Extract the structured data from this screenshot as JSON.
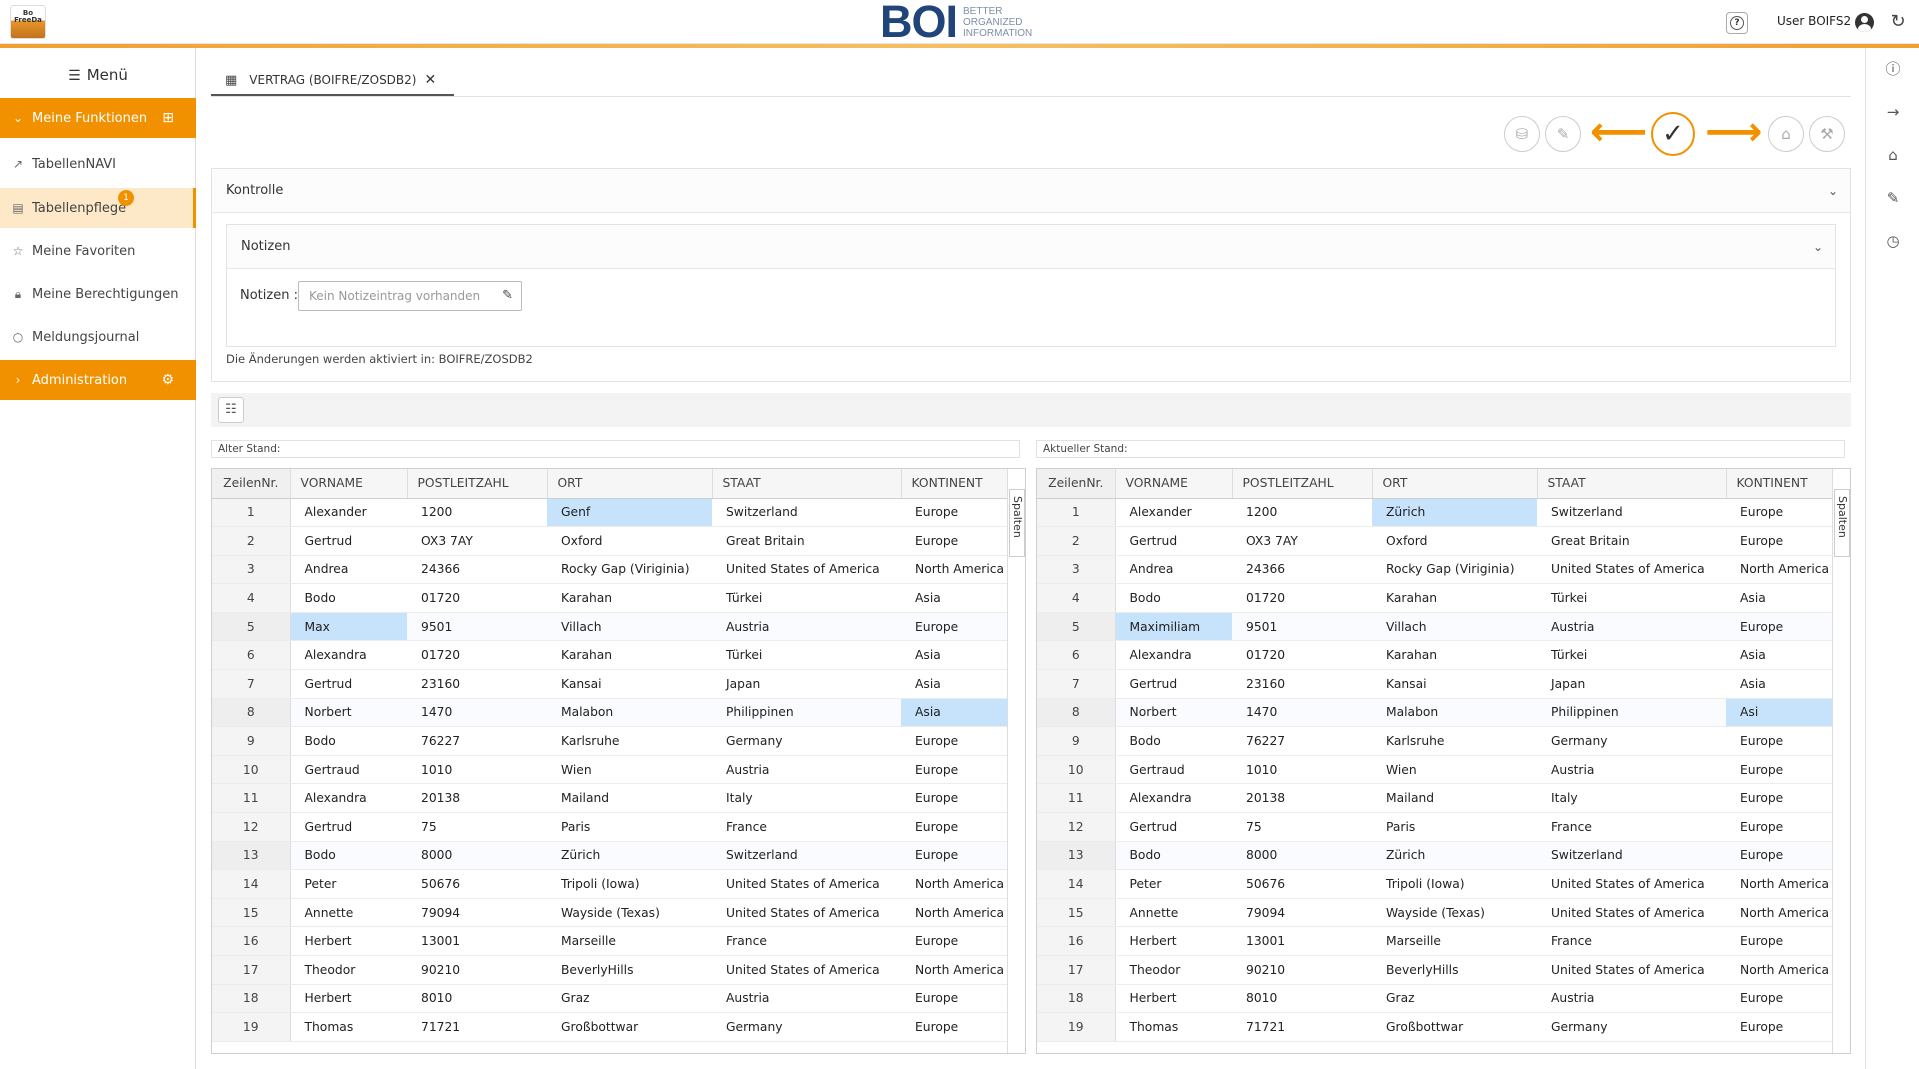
{
  "header": {
    "app_logo_text": "Bo FreeDa",
    "brand_mark": "BOI",
    "brand_lines": [
      "BETTER",
      "ORGANIZED",
      "INFORMATION"
    ],
    "user_label": "User BOIFS2"
  },
  "sidebar": {
    "menu_label": "Menü",
    "items": [
      {
        "label": "Meine Funktionen"
      },
      {
        "label": "TabellenNAVI"
      },
      {
        "label": "Tabellenpflege",
        "badge": "1"
      },
      {
        "label": "Meine Favoriten"
      },
      {
        "label": "Meine Berechtigungen"
      },
      {
        "label": "Meldungsjournal"
      },
      {
        "label": "Administration"
      }
    ]
  },
  "tab": {
    "label": "VERTRAG (BOIFRE/ZOSDB2)"
  },
  "kontrolle": {
    "title": "Kontrolle"
  },
  "notizen": {
    "title": "Notizen",
    "field_label": "Notizen :",
    "placeholder": "Kein Notizeintrag vorhanden"
  },
  "activation_note": "Die Änderungen werden aktiviert in: BOIFRE/ZOSDB2",
  "old_label": "Alter Stand:",
  "new_label": "Aktueller Stand:",
  "columns": [
    "ZeilenNr.",
    "VORNAME",
    "POSTLEITZAHL",
    "ORT",
    "STAAT",
    "KONTINENT"
  ],
  "spalten_label": "Spalten",
  "old_rows": [
    [
      "1",
      "Alexander",
      "1200",
      "Genf",
      "Switzerland",
      "Europe"
    ],
    [
      "2",
      "Gertrud",
      "OX3 7AY",
      "Oxford",
      "Great Britain",
      "Europe"
    ],
    [
      "3",
      "Andrea",
      "24366",
      "Rocky Gap (Viriginia)",
      "United States of America",
      "North America"
    ],
    [
      "4",
      "Bodo",
      "01720",
      "Karahan",
      "Türkei",
      "Asia"
    ],
    [
      "5",
      "Max",
      "9501",
      "Villach",
      "Austria",
      "Europe"
    ],
    [
      "6",
      "Alexandra",
      "01720",
      "Karahan",
      "Türkei",
      "Asia"
    ],
    [
      "7",
      "Gertrud",
      "23160",
      "Kansai",
      "Japan",
      "Asia"
    ],
    [
      "8",
      "Norbert",
      "1470",
      "Malabon",
      "Philippinen",
      "Asia"
    ],
    [
      "9",
      "Bodo",
      "76227",
      "Karlsruhe",
      "Germany",
      "Europe"
    ],
    [
      "10",
      "Gertraud",
      "1010",
      "Wien",
      "Austria",
      "Europe"
    ],
    [
      "11",
      "Alexandra",
      "20138",
      "Mailand",
      "Italy",
      "Europe"
    ],
    [
      "12",
      "Gertrud",
      "75",
      "Paris",
      "France",
      "Europe"
    ],
    [
      "13",
      "Bodo",
      "8000",
      "Zürich",
      "Switzerland",
      "Europe"
    ],
    [
      "14",
      "Peter",
      "50676",
      "Tripoli (Iowa)",
      "United States of America",
      "North America"
    ],
    [
      "15",
      "Annette",
      "79094",
      "Wayside (Texas)",
      "United States of America",
      "North America"
    ],
    [
      "16",
      "Herbert",
      "13001",
      "Marseille",
      "France",
      "Europe"
    ],
    [
      "17",
      "Theodor",
      "90210",
      "BeverlyHills",
      "United States of America",
      "North America"
    ],
    [
      "18",
      "Herbert",
      "8010",
      "Graz",
      "Austria",
      "Europe"
    ],
    [
      "19",
      "Thomas",
      "71721",
      "Großbottwar",
      "Germany",
      "Europe"
    ]
  ],
  "new_rows": [
    [
      "1",
      "Alexander",
      "1200",
      "Zürich",
      "Switzerland",
      "Europe"
    ],
    [
      "2",
      "Gertrud",
      "OX3 7AY",
      "Oxford",
      "Great Britain",
      "Europe"
    ],
    [
      "3",
      "Andrea",
      "24366",
      "Rocky Gap (Viriginia)",
      "United States of America",
      "North America"
    ],
    [
      "4",
      "Bodo",
      "01720",
      "Karahan",
      "Türkei",
      "Asia"
    ],
    [
      "5",
      "Maximiliam",
      "9501",
      "Villach",
      "Austria",
      "Europe"
    ],
    [
      "6",
      "Alexandra",
      "01720",
      "Karahan",
      "Türkei",
      "Asia"
    ],
    [
      "7",
      "Gertrud",
      "23160",
      "Kansai",
      "Japan",
      "Asia"
    ],
    [
      "8",
      "Norbert",
      "1470",
      "Malabon",
      "Philippinen",
      "Asi"
    ],
    [
      "9",
      "Bodo",
      "76227",
      "Karlsruhe",
      "Germany",
      "Europe"
    ],
    [
      "10",
      "Gertraud",
      "1010",
      "Wien",
      "Austria",
      "Europe"
    ],
    [
      "11",
      "Alexandra",
      "20138",
      "Mailand",
      "Italy",
      "Europe"
    ],
    [
      "12",
      "Gertrud",
      "75",
      "Paris",
      "France",
      "Europe"
    ],
    [
      "13",
      "Bodo",
      "8000",
      "Zürich",
      "Switzerland",
      "Europe"
    ],
    [
      "14",
      "Peter",
      "50676",
      "Tripoli (Iowa)",
      "United States of America",
      "North America"
    ],
    [
      "15",
      "Annette",
      "79094",
      "Wayside (Texas)",
      "United States of America",
      "North America"
    ],
    [
      "16",
      "Herbert",
      "13001",
      "Marseille",
      "France",
      "Europe"
    ],
    [
      "17",
      "Theodor",
      "90210",
      "BeverlyHills",
      "United States of America",
      "North America"
    ],
    [
      "18",
      "Herbert",
      "8010",
      "Graz",
      "Austria",
      "Europe"
    ],
    [
      "19",
      "Thomas",
      "71721",
      "Großbottwar",
      "Germany",
      "Europe"
    ]
  ],
  "changed_cells": [
    [
      0,
      3
    ],
    [
      4,
      1
    ],
    [
      7,
      5
    ]
  ],
  "colors": {
    "accent": "#f29100",
    "brand": "#21457a",
    "highlight": "#c7e2fb"
  }
}
